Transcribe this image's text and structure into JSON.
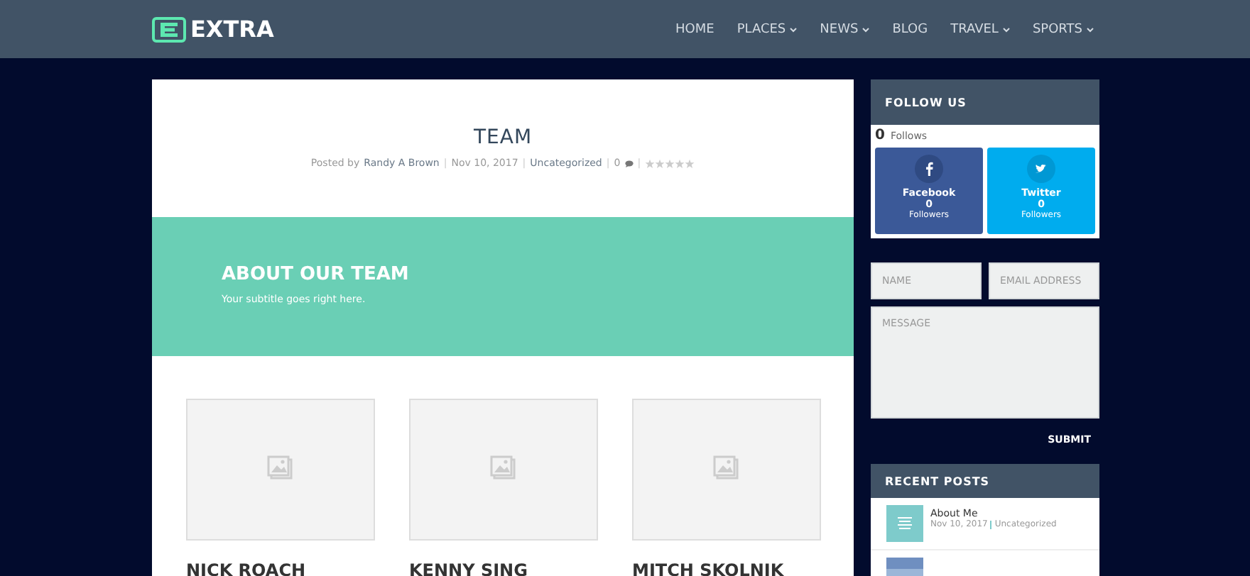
{
  "header": {
    "logo_text": "EXTRA",
    "nav": [
      {
        "label": "HOME",
        "dropdown": false
      },
      {
        "label": "PLACES",
        "dropdown": true
      },
      {
        "label": "NEWS",
        "dropdown": true
      },
      {
        "label": "BLOG",
        "dropdown": false
      },
      {
        "label": "TRAVEL",
        "dropdown": true
      },
      {
        "label": "SPORTS",
        "dropdown": true
      }
    ]
  },
  "post": {
    "title": "TEAM",
    "meta_prefix": "Posted by",
    "author": "Randy A Brown",
    "date": "Nov 10, 2017",
    "category": "Uncategorized",
    "comments": "0",
    "stars": 0,
    "separators": [
      "|",
      "|",
      "|",
      "|"
    ]
  },
  "banner": {
    "title": "ABOUT OUR TEAM",
    "subtitle": "Your subtitle goes right here."
  },
  "team": [
    {
      "name": "NICK ROACH"
    },
    {
      "name": "KENNY SING"
    },
    {
      "name": "MITCH SKOLNIK"
    }
  ],
  "follow": {
    "title": "FOLLOW US",
    "count": "0",
    "count_label": "Follows",
    "networks": [
      {
        "kind": "facebook",
        "name": "Facebook",
        "count": "0",
        "label": "Followers"
      },
      {
        "kind": "twitter",
        "name": "Twitter",
        "count": "0",
        "label": "Followers"
      }
    ]
  },
  "contact": {
    "name_placeholder": "NAME",
    "email_placeholder": "EMAIL ADDRESS",
    "message_placeholder": "MESSAGE",
    "submit": "SUBMIT"
  },
  "recent": {
    "title": "RECENT POSTS",
    "posts": [
      {
        "kind": "text",
        "title": "About Me",
        "date": "Nov 10, 2017",
        "category": "Uncategorized"
      },
      {
        "kind": "picture"
      }
    ]
  }
}
